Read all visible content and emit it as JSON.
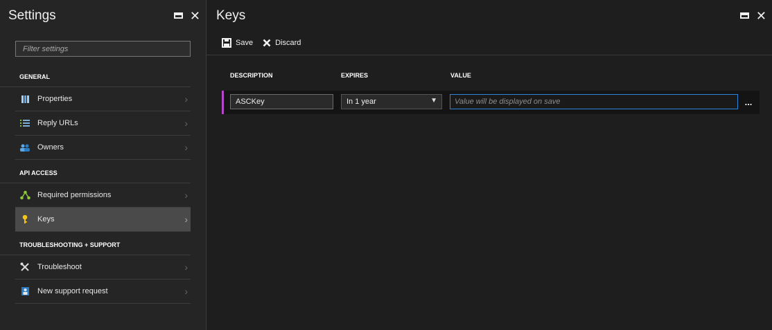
{
  "settings": {
    "title": "Settings",
    "filter_placeholder": "Filter settings",
    "sections": [
      {
        "title": "GENERAL",
        "items": [
          {
            "label": "Properties",
            "icon": "properties-icon"
          },
          {
            "label": "Reply URLs",
            "icon": "list-icon"
          },
          {
            "label": "Owners",
            "icon": "owners-icon"
          }
        ]
      },
      {
        "title": "API ACCESS",
        "items": [
          {
            "label": "Required permissions",
            "icon": "permissions-icon"
          },
          {
            "label": "Keys",
            "icon": "key-icon",
            "active": true
          }
        ]
      },
      {
        "title": "TROUBLESHOOTING + SUPPORT",
        "items": [
          {
            "label": "Troubleshoot",
            "icon": "tools-icon"
          },
          {
            "label": "New support request",
            "icon": "support-icon"
          }
        ]
      }
    ]
  },
  "keys": {
    "title": "Keys",
    "toolbar": {
      "save_label": "Save",
      "discard_label": "Discard"
    },
    "columns": {
      "description": "DESCRIPTION",
      "expires": "EXPIRES",
      "value": "VALUE"
    },
    "row": {
      "description": "ASCKey",
      "expires": "In 1 year",
      "value_placeholder": "Value will be displayed on save",
      "more": "..."
    }
  },
  "colors": {
    "accent": "#b547c9",
    "focus": "#2d86d8",
    "active_item": "#4a4a4a"
  }
}
